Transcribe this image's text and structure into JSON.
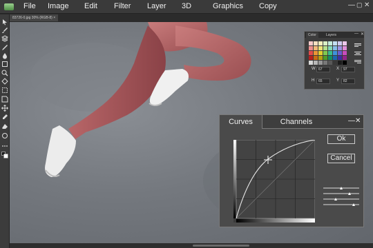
{
  "menu": {
    "items": [
      "File",
      "Image",
      "Edit",
      "Filter",
      "Layer",
      "3D",
      "Graphics",
      "Copy"
    ]
  },
  "document": {
    "tab_label": "83726-0.jpg 30% (RGB-8) ×"
  },
  "tools": [
    "move-icon",
    "brush-icon",
    "layers-icon",
    "pencil-icon",
    "drop-icon",
    "rectangle-icon",
    "zoom-icon",
    "fill-icon",
    "marquee-icon",
    "crop-icon",
    "pan-icon",
    "eyedropper-icon",
    "eraser-icon",
    "ellipse-icon",
    "more-icon",
    "color-swap-icon"
  ],
  "color_panel": {
    "tabs": [
      "Color",
      "Layers"
    ],
    "fields": {
      "w_label": "W",
      "w_value": "67",
      "x_label": "X",
      "x_value": "97",
      "h_label": "H",
      "h_value": "65",
      "y_label": "Y",
      "y_value": "82"
    },
    "swatches": [
      "#f7c9c9",
      "#f7dfc0",
      "#f5efbd",
      "#d9efc4",
      "#c4ecdc",
      "#c4dff2",
      "#cfcaf0",
      "#ecc7ea",
      "#ef8f8f",
      "#f2b97a",
      "#eee27a",
      "#b5df8c",
      "#86d9b8",
      "#86bde8",
      "#9e95e3",
      "#df8ed8",
      "#e34a4a",
      "#ec9536",
      "#e3cf2f",
      "#82c94f",
      "#38bf8c",
      "#3e93db",
      "#6b5cd2",
      "#c94cbd",
      "#b51f1f",
      "#c76b14",
      "#b89f12",
      "#4f9b27",
      "#158f63",
      "#1b66ad",
      "#3d2fa3",
      "#93238a",
      "#d8d8d8",
      "#b8b8b8",
      "#989898",
      "#787878",
      "#585858",
      "#383838",
      "#1c1c1c",
      "#000000"
    ]
  },
  "curves_dialog": {
    "tabs": [
      "Curves",
      "Channels"
    ],
    "ok_label": "Ok",
    "cancel_label": "Cancel"
  }
}
